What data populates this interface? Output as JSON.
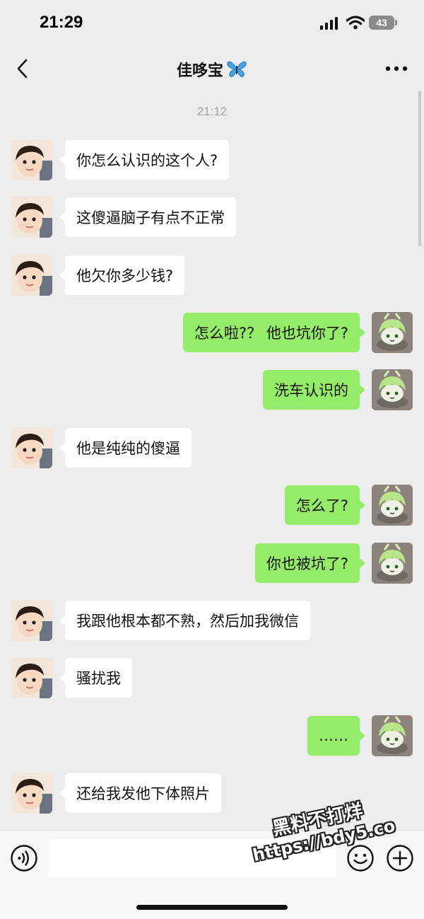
{
  "status_bar": {
    "time": "21:29",
    "battery": "43"
  },
  "header": {
    "back_icon": "chevron-left-icon",
    "title": "佳哆宝",
    "title_emoji": "butterfly-icon",
    "more_icon": "more-dots-icon"
  },
  "chat": {
    "timestamp": "21:12",
    "messages": [
      {
        "side": "left",
        "text": "你怎么认识的这个人?"
      },
      {
        "side": "left",
        "text": "这傻逼脑子有点不正常"
      },
      {
        "side": "left",
        "text": "他欠你多少钱?"
      },
      {
        "side": "right",
        "text": "怎么啦?？ 他也坑你了?"
      },
      {
        "side": "right",
        "text": "洗车认识的"
      },
      {
        "side": "left",
        "text": "他是纯纯的傻逼"
      },
      {
        "side": "right",
        "text": "怎么了?"
      },
      {
        "side": "right",
        "text": "你也被坑了?"
      },
      {
        "side": "left",
        "text": "我跟他根本都不熟，然后加我微信"
      },
      {
        "side": "left",
        "text": "骚扰我"
      },
      {
        "side": "right",
        "text": "……"
      },
      {
        "side": "left",
        "text": "还给我发他下体照片"
      }
    ]
  },
  "input_bar": {
    "voice_icon": "voice-icon",
    "placeholder": "",
    "emoji_icon": "emoji-icon",
    "add_icon": "plus-icon"
  },
  "watermark": {
    "line1": "黑料不打烊",
    "line2": "https://bdy5.co"
  },
  "colors": {
    "background": "#ededed",
    "incoming_bubble": "#ffffff",
    "outgoing_bubble": "#95ec69",
    "timestamp": "#a3a3a3"
  }
}
